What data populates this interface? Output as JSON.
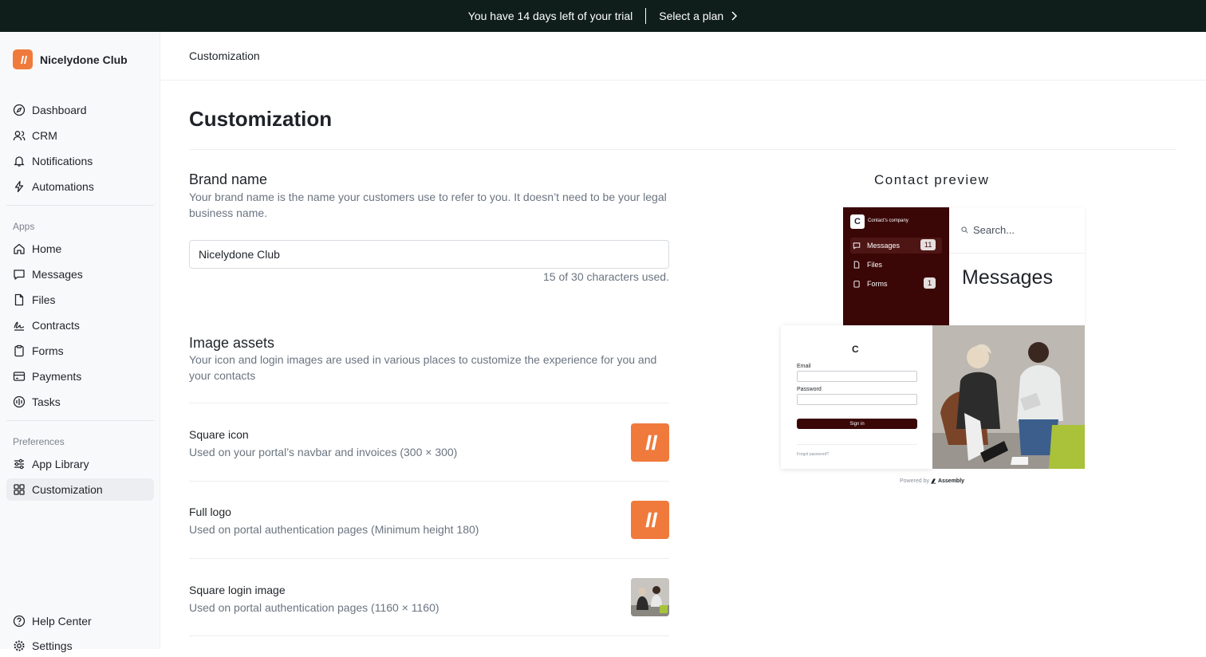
{
  "banner": {
    "trial_text": "You have 14 days left of your trial",
    "plan_label": "Select a plan"
  },
  "sidebar": {
    "brand": "Nicelydone Club",
    "items_top": [
      {
        "label": "Dashboard",
        "icon": "compass-icon"
      },
      {
        "label": "CRM",
        "icon": "users-icon"
      },
      {
        "label": "Notifications",
        "icon": "bell-icon"
      },
      {
        "label": "Automations",
        "icon": "bolt-icon"
      }
    ],
    "apps_label": "Apps",
    "apps": [
      {
        "label": "Home",
        "icon": "home-icon"
      },
      {
        "label": "Messages",
        "icon": "message-icon"
      },
      {
        "label": "Files",
        "icon": "file-icon"
      },
      {
        "label": "Contracts",
        "icon": "signature-icon"
      },
      {
        "label": "Forms",
        "icon": "clipboard-icon"
      },
      {
        "label": "Payments",
        "icon": "credit-card-icon"
      },
      {
        "label": "Tasks",
        "icon": "tasks-icon"
      }
    ],
    "prefs_label": "Preferences",
    "prefs": [
      {
        "label": "App Library",
        "icon": "sliders-icon"
      },
      {
        "label": "Customization",
        "icon": "grid-icon",
        "active": true
      }
    ],
    "bottom": [
      {
        "label": "Help Center",
        "icon": "help-icon"
      },
      {
        "label": "Settings",
        "icon": "gear-icon"
      }
    ]
  },
  "breadcrumb": "Customization",
  "page_title": "Customization",
  "brand_section": {
    "title": "Brand name",
    "description": "Your brand name is the name your customers use to refer to you. It doesn’t need to be your legal business name.",
    "value": "Nicelydone Club",
    "count": "15 of 30 characters used."
  },
  "image_section": {
    "title": "Image assets",
    "description": "Your icon and login images are used in various places to customize the experience for you and your contacts",
    "assets": [
      {
        "title": "Square icon",
        "desc": "Used on your portal’s navbar and invoices (300 × 300)"
      },
      {
        "title": "Full logo",
        "desc": "Used on portal authentication pages (Minimum height 180)"
      },
      {
        "title": "Square login image",
        "desc": "Used on portal authentication pages (1160 × 1160)"
      }
    ]
  },
  "preview": {
    "title": "Contact preview",
    "company_initial": "C",
    "company_name": "Contact's company",
    "search_placeholder": "Search...",
    "heading": "Messages",
    "nav": [
      {
        "label": "Messages",
        "badge": "11"
      },
      {
        "label": "Files",
        "badge": ""
      },
      {
        "label": "Forms",
        "badge": "1"
      }
    ],
    "login_initial": "C",
    "email_label": "Email",
    "password_label": "Password",
    "signin_label": "Sign in",
    "forgot_label": "Forgot password?",
    "powered_by": "Powered by",
    "powered_brand": "Assembly"
  },
  "colors": {
    "accent": "#f07a3c",
    "banner": "#0f1e1a",
    "portal": "#3a0606"
  }
}
